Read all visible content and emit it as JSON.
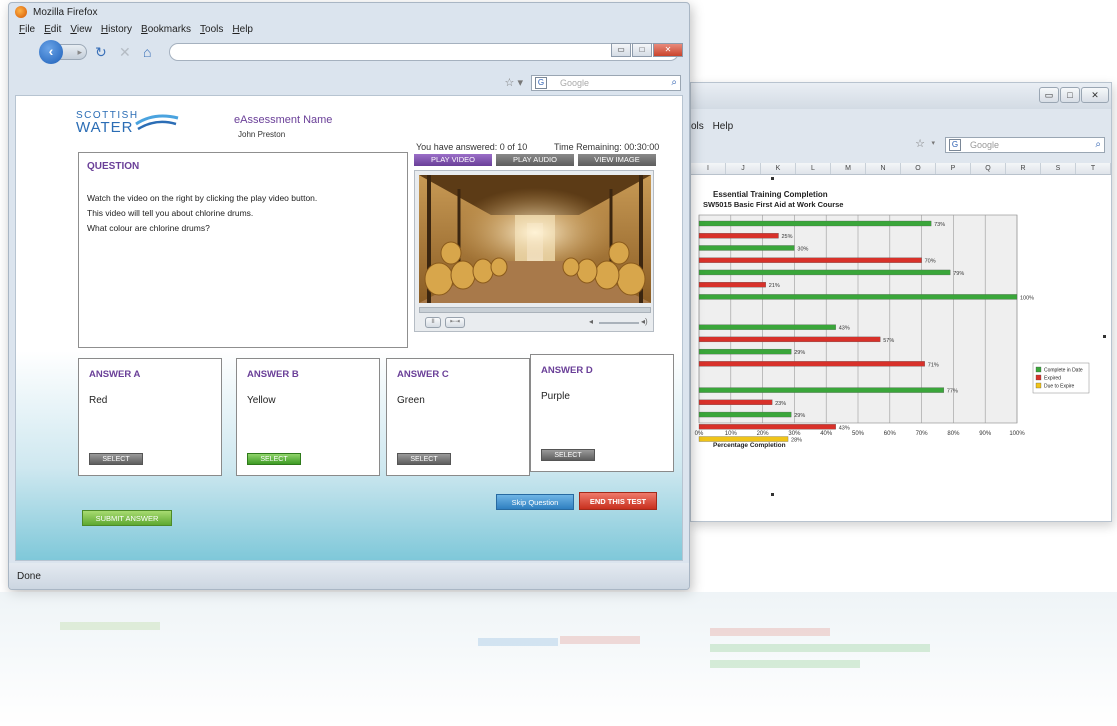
{
  "browser": {
    "window_title": "Mozilla Firefox",
    "menu": [
      "File",
      "Edit",
      "View",
      "History",
      "Bookmarks",
      "Tools",
      "Help"
    ],
    "search_placeholder": "Google",
    "status": "Done",
    "icons": [
      "firefox-logo-icon",
      "back-icon",
      "forward-icon",
      "reload-icon",
      "stop-icon",
      "home-icon",
      "star-icon",
      "search-icon"
    ]
  },
  "assessment": {
    "logo_line1": "SCOTTISH",
    "logo_line2": "WATER",
    "name": "eAssessment Name",
    "candidate": "John Preston",
    "answered": "You have answered: 0  of 10",
    "time_remaining": "Time Remaining: 00:30:00",
    "question_label": "QUESTION",
    "question_lines": [
      "Watch the video on the right by clicking the play video button.",
      "This video will tell you about chlorine drums.",
      "What colour are chlorine drums?"
    ],
    "media_tabs": [
      "PLAY VIDEO",
      "PLAY AUDIO",
      "VIEW IMAGE"
    ],
    "active_media_tab": 0,
    "answers": [
      {
        "label": "ANSWER A",
        "text": "Red",
        "button": "SELECT",
        "selected": false
      },
      {
        "label": "ANSWER B",
        "text": "Yellow",
        "button": "SELECT",
        "selected": true
      },
      {
        "label": "ANSWER C",
        "text": "Green",
        "button": "SELECT",
        "selected": false
      },
      {
        "label": "ANSWER D",
        "text": "Purple",
        "button": "SELECT",
        "selected": false
      }
    ],
    "submit_label": "SUBMIT ANSWER",
    "skip_label": "Skip Question",
    "end_label": "END THIS TEST"
  },
  "back_window": {
    "menu": [
      "ols",
      "Help"
    ],
    "search_placeholder": "Google",
    "columns": [
      "I",
      "J",
      "K",
      "L",
      "M",
      "N",
      "O",
      "P",
      "Q",
      "R",
      "S",
      "T"
    ]
  },
  "chart_data": {
    "type": "bar",
    "orientation": "horizontal",
    "title": "Essential Training Completion",
    "subtitle": "SW5015 Basic First Aid at Work Course",
    "xlabel": "Percentage Completion",
    "xlim": [
      0,
      100
    ],
    "xticks": [
      "0%",
      "10%",
      "20%",
      "30%",
      "40%",
      "50%",
      "60%",
      "70%",
      "80%",
      "90%",
      "100%"
    ],
    "legend": [
      "Complete in Date",
      "Expired",
      "Due to Expire"
    ],
    "legend_position": "right",
    "colors": {
      "Complete in Date": "#3aa63a",
      "Expired": "#d8312a",
      "Due to Expire": "#f0c419"
    },
    "bars": [
      {
        "series": "Complete in Date",
        "value": 73,
        "label": "73%"
      },
      {
        "series": "Expired",
        "value": 25,
        "label": "25%"
      },
      {
        "series": "Complete in Date",
        "value": 30,
        "label": "30%"
      },
      {
        "series": "Expired",
        "value": 70,
        "label": "70%"
      },
      {
        "series": "Complete in Date",
        "value": 79,
        "label": "79%"
      },
      {
        "series": "Expired",
        "value": 21,
        "label": "21%"
      },
      {
        "series": "Complete in Date",
        "value": 100,
        "label": "100%"
      },
      {
        "series": "Complete in Date",
        "value": 43,
        "label": "43%"
      },
      {
        "series": "Expired",
        "value": 57,
        "label": "57%"
      },
      {
        "series": "Complete in Date",
        "value": 29,
        "label": "29%"
      },
      {
        "series": "Expired",
        "value": 71,
        "label": "71%"
      },
      {
        "series": "Complete in Date",
        "value": 77,
        "label": "77%"
      },
      {
        "series": "Expired",
        "value": 23,
        "label": "23%"
      },
      {
        "series": "Complete in Date",
        "value": 29,
        "label": "29%"
      },
      {
        "series": "Expired",
        "value": 43,
        "label": "43%"
      },
      {
        "series": "Due to Expire",
        "value": 28,
        "label": "28%"
      }
    ]
  }
}
